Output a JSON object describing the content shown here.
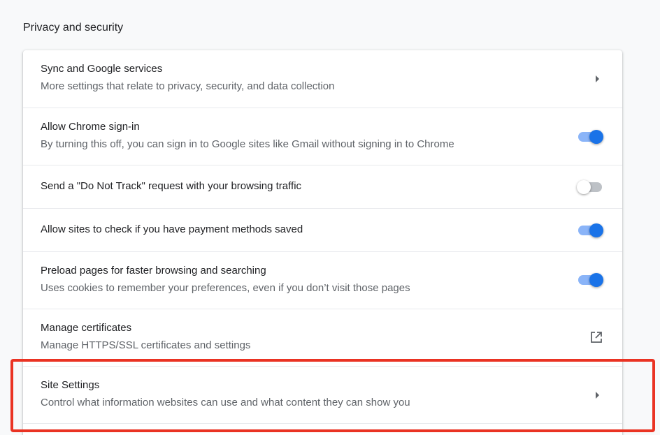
{
  "section": {
    "title": "Privacy and security"
  },
  "rows": [
    {
      "title": "Sync and Google services",
      "subtitle": "More settings that relate to privacy, security, and data collection",
      "control": "arrow"
    },
    {
      "title": "Allow Chrome sign-in",
      "subtitle": "By turning this off, you can sign in to Google sites like Gmail without signing in to Chrome",
      "control": "toggle",
      "enabled": true
    },
    {
      "title": "Send a \"Do Not Track\" request with your browsing traffic",
      "control": "toggle",
      "enabled": false
    },
    {
      "title": "Allow sites to check if you have payment methods saved",
      "control": "toggle",
      "enabled": true
    },
    {
      "title": "Preload pages for faster browsing and searching",
      "subtitle": "Uses cookies to remember your preferences, even if you don’t visit those pages",
      "control": "toggle",
      "enabled": true
    },
    {
      "title": "Manage certificates",
      "subtitle": "Manage HTTPS/SSL certificates and settings",
      "control": "external-link-icon"
    },
    {
      "title": "Site Settings",
      "subtitle": "Control what information websites can use and what content they can show you",
      "control": "arrow",
      "highlighted": true
    }
  ],
  "colors": {
    "accent": "#1a73e8",
    "highlight": "#ea3323"
  }
}
